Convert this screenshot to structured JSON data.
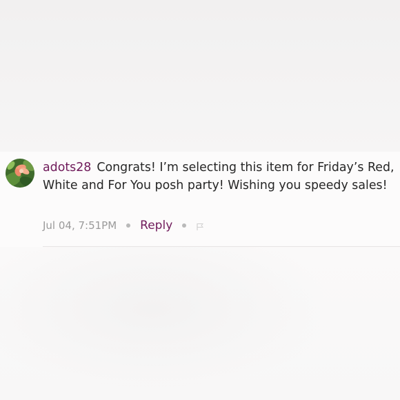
{
  "comment": {
    "username": "adots28",
    "text": "Congrats! I’m selecting this item for Friday’s Red, White and For You posh party! Wishing you speedy sales!",
    "timestamp": "Jul 04, 7:51PM",
    "reply_label": "Reply",
    "separator_icon": "dot",
    "flag_icon": "flag-icon",
    "accent_color": "#6f1a5a"
  }
}
